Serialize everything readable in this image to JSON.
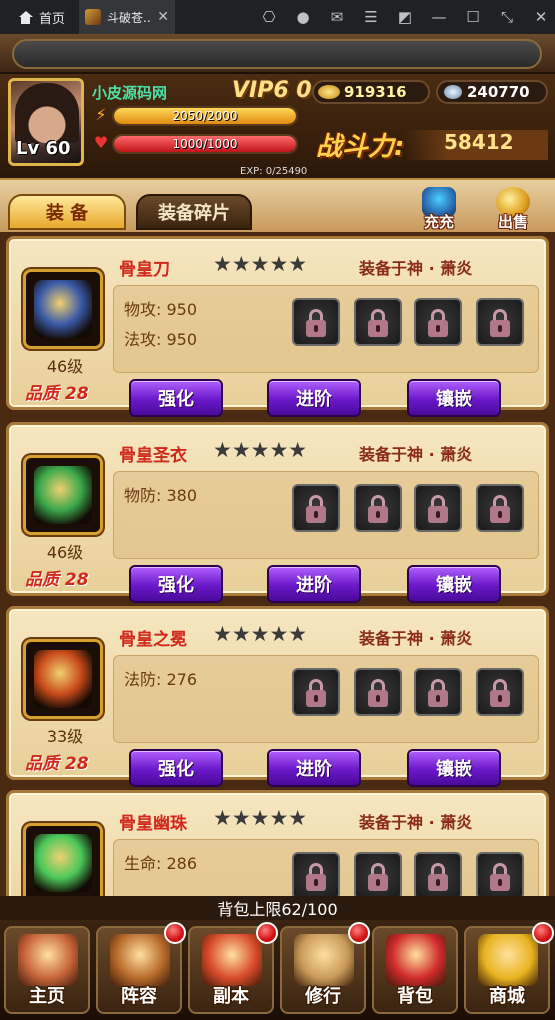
{
  "browser": {
    "home_label": "首页",
    "tab_title": "斗破苍...",
    "tab_close": "✕",
    "icons": [
      "gamepad-icon",
      "user-icon",
      "mail-icon",
      "menu-icon",
      "pin-icon",
      "minimize-icon",
      "maximize-icon",
      "collapse-icon",
      "close-icon"
    ],
    "icon_glyphs": [
      "⎔",
      "●",
      "✉",
      "☰",
      "◩",
      "—",
      "☐",
      "⤡",
      "✕"
    ]
  },
  "player": {
    "name": "小皮源码网",
    "level_text": "Lv 60",
    "vip_text": "VIP6 0",
    "gold": "919316",
    "diamond": "240770",
    "stamina_text": "2050/2000",
    "stamina_fraction": 1.0,
    "hp_text": "1000/1000",
    "hp_fraction": 1.0,
    "power_label": "战斗力:",
    "power_value": "58412",
    "exp_text": "EXP: 0/25490"
  },
  "tabs": {
    "equipment": "装 备",
    "fragments": "装备碎片"
  },
  "actions": {
    "recharge": "充充",
    "sell": "出售"
  },
  "equipment": [
    {
      "name": "骨皇刀",
      "stars": "★★★★★",
      "equipped_by": "装备于神 · 萧炎",
      "level": "46级",
      "quality": "品质 28",
      "stats": [
        "物攻: 950",
        "法攻: 950"
      ],
      "art_color": "#3a5aa8",
      "buttons": [
        "强化",
        "进阶",
        "镶嵌"
      ]
    },
    {
      "name": "骨皇圣衣",
      "stars": "★★★★★",
      "equipped_by": "装备于神 · 萧炎",
      "level": "46级",
      "quality": "品质 28",
      "stats": [
        "物防: 380"
      ],
      "art_color": "#3aa84a",
      "buttons": [
        "强化",
        "进阶",
        "镶嵌"
      ]
    },
    {
      "name": "骨皇之冕",
      "stars": "★★★★★",
      "equipped_by": "装备于神 · 萧炎",
      "level": "33级",
      "quality": "品质 28",
      "stats": [
        "法防: 276"
      ],
      "art_color": "#c84a1a",
      "buttons": [
        "强化",
        "进阶",
        "镶嵌"
      ]
    },
    {
      "name": "骨皇幽珠",
      "stars": "★★★★★",
      "equipped_by": "装备于神 · 萧炎",
      "level": "",
      "quality": "",
      "stats": [
        "生命: 286"
      ],
      "art_color": "#4ac85a",
      "buttons": []
    }
  ],
  "bag": {
    "capacity_text": "背包上限62/100"
  },
  "nav": [
    {
      "label": "主页",
      "badge": false,
      "art": "#c8643a"
    },
    {
      "label": "阵容",
      "badge": true,
      "art": "#b86a2a"
    },
    {
      "label": "副本",
      "badge": true,
      "art": "#d84a2a"
    },
    {
      "label": "修行",
      "badge": true,
      "art": "#c89a5a"
    },
    {
      "label": "背包",
      "badge": false,
      "art": "#d02a2a"
    },
    {
      "label": "商城",
      "badge": true,
      "art": "#e8b420"
    }
  ]
}
